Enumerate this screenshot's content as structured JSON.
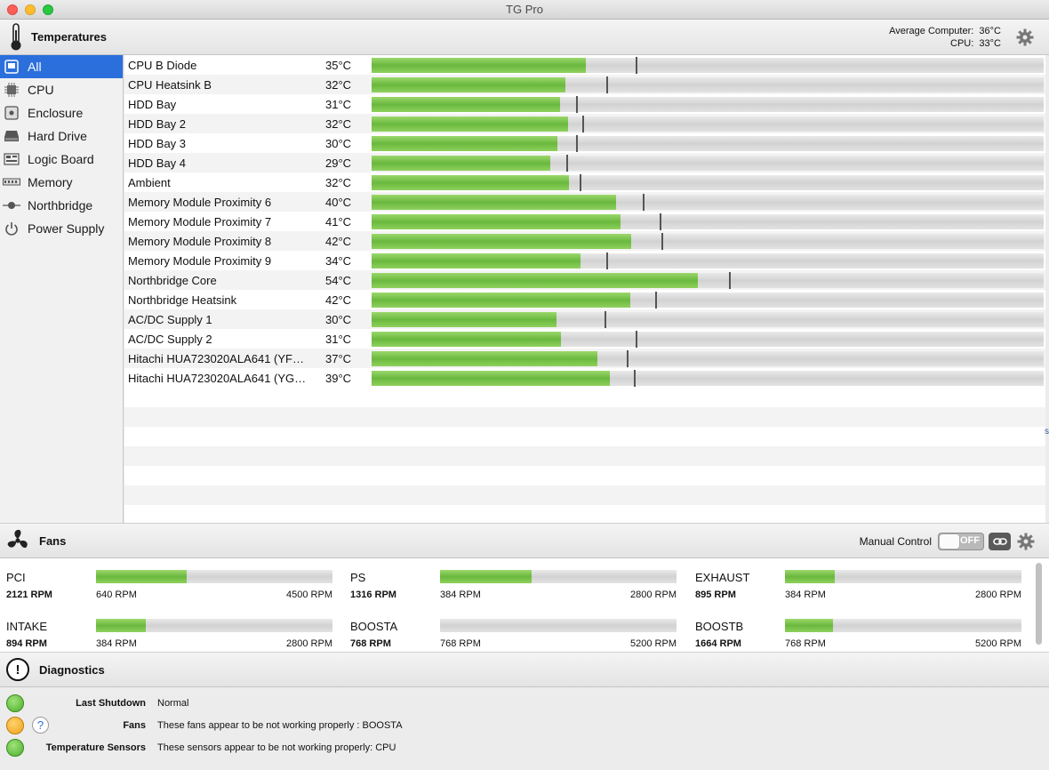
{
  "window": {
    "title": "TG Pro"
  },
  "temperatures": {
    "title": "Temperatures",
    "average_computer_label": "Average Computer:",
    "average_computer_value": "36°C",
    "cpu_label": "CPU:",
    "cpu_value": "33°C"
  },
  "sidebar": {
    "items": [
      {
        "label": "All",
        "icon": "all-icon"
      },
      {
        "label": "CPU",
        "icon": "cpu-chip-icon"
      },
      {
        "label": "Enclosure",
        "icon": "enclosure-icon"
      },
      {
        "label": "Hard Drive",
        "icon": "hard-drive-icon"
      },
      {
        "label": "Logic Board",
        "icon": "logic-board-icon"
      },
      {
        "label": "Memory",
        "icon": "memory-icon"
      },
      {
        "label": "Northbridge",
        "icon": "northbridge-icon"
      },
      {
        "label": "Power Supply",
        "icon": "power-icon"
      }
    ]
  },
  "sensors": [
    {
      "name": "CPU B Diode",
      "temp": "35°C",
      "fill": 0.319,
      "max": 0.393
    },
    {
      "name": "CPU Heatsink B",
      "temp": "32°C",
      "fill": 0.289,
      "max": 0.349
    },
    {
      "name": "HDD Bay",
      "temp": "31°C",
      "fill": 0.28,
      "max": 0.304
    },
    {
      "name": "HDD Bay 2",
      "temp": "32°C",
      "fill": 0.292,
      "max": 0.313
    },
    {
      "name": "HDD Bay 3",
      "temp": "30°C",
      "fill": 0.277,
      "max": 0.304
    },
    {
      "name": "HDD Bay 4",
      "temp": "29°C",
      "fill": 0.266,
      "max": 0.29
    },
    {
      "name": "Ambient",
      "temp": "32°C",
      "fill": 0.294,
      "max": 0.309
    },
    {
      "name": "Memory Module Proximity 6",
      "temp": "40°C",
      "fill": 0.364,
      "max": 0.403
    },
    {
      "name": "Memory Module Proximity 7",
      "temp": "41°C",
      "fill": 0.37,
      "max": 0.429
    },
    {
      "name": "Memory Module Proximity 8",
      "temp": "42°C",
      "fill": 0.386,
      "max": 0.431
    },
    {
      "name": "Memory Module Proximity 9",
      "temp": "34°C",
      "fill": 0.311,
      "max": 0.349
    },
    {
      "name": "Northbridge Core",
      "temp": "54°C",
      "fill": 0.486,
      "max": 0.532
    },
    {
      "name": "Northbridge Heatsink",
      "temp": "42°C",
      "fill": 0.385,
      "max": 0.422
    },
    {
      "name": "AC/DC Supply 1",
      "temp": "30°C",
      "fill": 0.275,
      "max": 0.347
    },
    {
      "name": "AC/DC Supply 2",
      "temp": "31°C",
      "fill": 0.282,
      "max": 0.393
    },
    {
      "name": "Hitachi HUA723020ALA641 (YF…",
      "temp": "37°C",
      "fill": 0.336,
      "max": 0.38
    },
    {
      "name": "Hitachi HUA723020ALA641 (YG…",
      "temp": "39°C",
      "fill": 0.354,
      "max": 0.39
    }
  ],
  "fans": {
    "title": "Fans",
    "manual_control_label": "Manual Control",
    "toggle_label": "OFF",
    "items": [
      {
        "name": "PCI",
        "rpm": "2121 RPM",
        "min": "640 RPM",
        "max": "4500 RPM",
        "fill": 0.385
      },
      {
        "name": "PS",
        "rpm": "1316 RPM",
        "min": "384 RPM",
        "max": "2800 RPM",
        "fill": 0.387
      },
      {
        "name": "EXHAUST",
        "rpm": "895 RPM",
        "min": "384 RPM",
        "max": "2800 RPM",
        "fill": 0.212
      },
      {
        "name": "INTAKE",
        "rpm": "894 RPM",
        "min": "384 RPM",
        "max": "2800 RPM",
        "fill": 0.211
      },
      {
        "name": "BOOSTA",
        "rpm": "768 RPM",
        "min": "768 RPM",
        "max": "5200 RPM",
        "fill": 0.0
      },
      {
        "name": "BOOSTB",
        "rpm": "1664 RPM",
        "min": "768 RPM",
        "max": "5200 RPM",
        "fill": 0.202
      }
    ]
  },
  "diagnostics": {
    "title": "Diagnostics",
    "rows": [
      {
        "label": "Last Shutdown",
        "text": "Normal",
        "status": "green"
      },
      {
        "label": "Fans",
        "text": "These fans appear to be not working properly : BOOSTA",
        "status": "orange",
        "help": "?"
      },
      {
        "label": "Temperature Sensors",
        "text": "These sensors appear to be not working properly: CPU",
        "status": "green"
      }
    ]
  },
  "edge_char": "s"
}
